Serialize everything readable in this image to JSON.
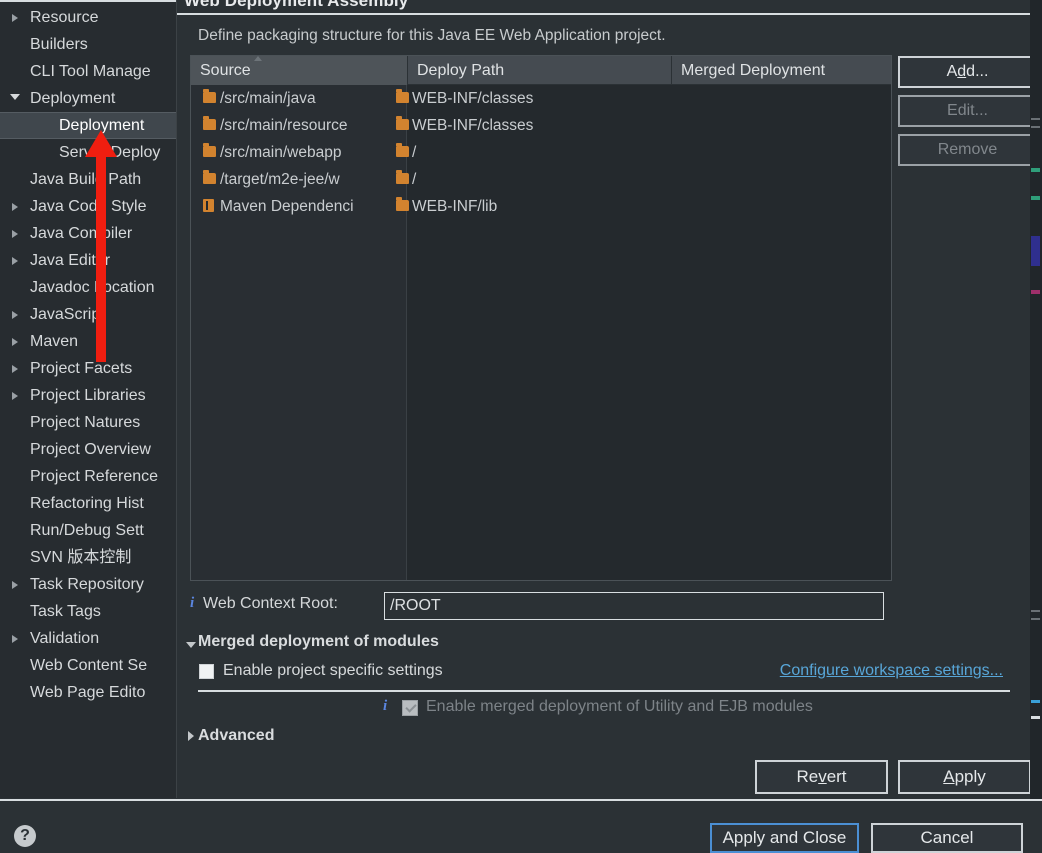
{
  "dialog": {
    "title": "Web Deployment Assembly",
    "description": "Define packaging structure for this Java EE Web Application project."
  },
  "tree": {
    "items": [
      {
        "label": "Resource",
        "twisty": "closed",
        "depth": 1,
        "selected": false
      },
      {
        "label": "Builders",
        "twisty": "none",
        "depth": 1,
        "selected": false
      },
      {
        "label": "CLI Tool Manage",
        "twisty": "none",
        "depth": 1,
        "selected": false
      },
      {
        "label": "Deployment",
        "twisty": "open",
        "depth": 1,
        "selected": false
      },
      {
        "label": "Deployment ",
        "twisty": "none",
        "depth": 2,
        "selected": true
      },
      {
        "label": "Server Deploy",
        "twisty": "none",
        "depth": 2,
        "selected": false
      },
      {
        "label": "Java Build Path",
        "twisty": "none",
        "depth": 1,
        "selected": false
      },
      {
        "label": "Java Code Style",
        "twisty": "closed",
        "depth": 1,
        "selected": false
      },
      {
        "label": "Java Compiler",
        "twisty": "closed",
        "depth": 1,
        "selected": false
      },
      {
        "label": "Java Editor",
        "twisty": "closed",
        "depth": 1,
        "selected": false
      },
      {
        "label": "Javadoc Location",
        "twisty": "none",
        "depth": 1,
        "selected": false
      },
      {
        "label": "JavaScript",
        "twisty": "closed",
        "depth": 1,
        "selected": false
      },
      {
        "label": "Maven",
        "twisty": "closed",
        "depth": 1,
        "selected": false
      },
      {
        "label": "Project Facets",
        "twisty": "closed",
        "depth": 1,
        "selected": false
      },
      {
        "label": "Project Libraries",
        "twisty": "closed",
        "depth": 1,
        "selected": false
      },
      {
        "label": "Project Natures",
        "twisty": "none",
        "depth": 1,
        "selected": false
      },
      {
        "label": "Project Overview",
        "twisty": "none",
        "depth": 1,
        "selected": false
      },
      {
        "label": "Project Reference",
        "twisty": "none",
        "depth": 1,
        "selected": false
      },
      {
        "label": "Refactoring Hist",
        "twisty": "none",
        "depth": 1,
        "selected": false
      },
      {
        "label": "Run/Debug Sett",
        "twisty": "none",
        "depth": 1,
        "selected": false
      },
      {
        "label": "SVN 版本控制",
        "twisty": "none",
        "depth": 1,
        "selected": false
      },
      {
        "label": "Task Repository",
        "twisty": "closed",
        "depth": 1,
        "selected": false
      },
      {
        "label": "Task Tags",
        "twisty": "none",
        "depth": 1,
        "selected": false
      },
      {
        "label": "Validation",
        "twisty": "closed",
        "depth": 1,
        "selected": false
      },
      {
        "label": "Web Content Se",
        "twisty": "none",
        "depth": 1,
        "selected": false
      },
      {
        "label": "Web Page Edito",
        "twisty": "none",
        "depth": 1,
        "selected": false
      }
    ]
  },
  "table": {
    "columns": [
      "Source",
      "Deploy Path",
      "Merged Deployment"
    ],
    "rows": [
      {
        "source": "/src/main/java",
        "source_icon": "folder-icon",
        "deploy": "WEB-INF/classes",
        "deploy_icon": "folder-icon",
        "merged": ""
      },
      {
        "source": "/src/main/resource",
        "source_icon": "folder-icon",
        "deploy": "WEB-INF/classes",
        "deploy_icon": "folder-icon",
        "merged": ""
      },
      {
        "source": "/src/main/webapp",
        "source_icon": "folder-icon",
        "deploy": "/",
        "deploy_icon": "folder-icon",
        "merged": ""
      },
      {
        "source": "/target/m2e-jee/w",
        "source_icon": "folder-icon",
        "deploy": "/",
        "deploy_icon": "folder-icon",
        "merged": ""
      },
      {
        "source": "Maven Dependenci",
        "source_icon": "library-icon",
        "deploy": "WEB-INF/lib",
        "deploy_icon": "folder-icon",
        "merged": ""
      }
    ]
  },
  "side_buttons": {
    "add": {
      "prefix": "A",
      "mnemonic": "d",
      "suffix": "d...",
      "enabled": true
    },
    "edit": {
      "label": "Edit...",
      "enabled": false
    },
    "remove": {
      "label": "Remove",
      "enabled": false
    }
  },
  "context_root": {
    "label": "Web Context Root:",
    "value": "/ROOT",
    "info_icon": "info-icon"
  },
  "merged_group": {
    "title": "Merged deployment of modules",
    "expanded": true,
    "project_specific": {
      "label": "Enable project specific settings",
      "checked": false
    },
    "configure_link": "Configure workspace settings...",
    "merged_modules": {
      "label": "Enable merged deployment of Utility and EJB modules",
      "checked": true,
      "enabled": false,
      "info_icon": "info-icon"
    }
  },
  "advanced": {
    "label": "Advanced",
    "expanded": false
  },
  "form_buttons": {
    "revert": {
      "prefix": "Re",
      "mnemonic": "v",
      "suffix": "ert"
    },
    "apply": {
      "prefix": "",
      "mnemonic": "A",
      "suffix": "pply"
    }
  },
  "bottom_bar": {
    "help_icon": "question-mark-icon",
    "apply_and_close": "Apply and Close",
    "cancel": "Cancel"
  },
  "annotation": {
    "type": "red-arrow",
    "color": "#f01e10",
    "points_to": "Deployment Assembly"
  },
  "colors": {
    "window_bg": "#2b3135",
    "tree_bg": "#272c30",
    "selection_bg": "#40474d",
    "table_header_bg": "#454b51",
    "folder_icon": "#d2832f",
    "link": "#58a6d8",
    "info": "#5b86e0",
    "accent_border": "#4b8fd4",
    "annotation": "#f01e10"
  }
}
